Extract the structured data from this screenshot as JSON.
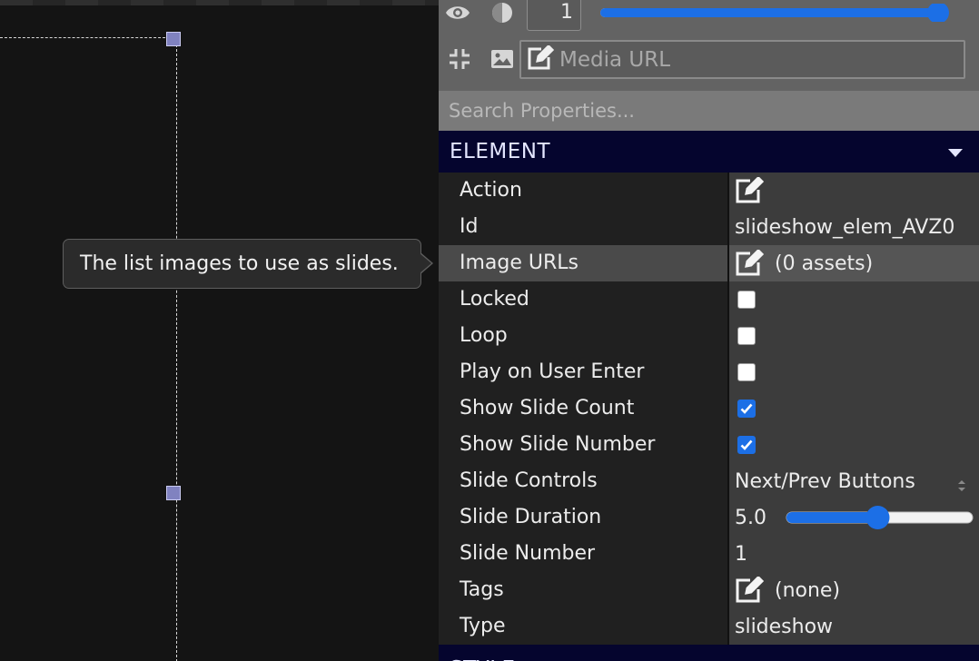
{
  "toolbar": {
    "opacity_value": "1",
    "opacity_level": 1.0,
    "media_url_placeholder": "Media URL",
    "icons": [
      "eye-icon",
      "contrast-icon",
      "collapse-icon",
      "image-icon",
      "edit-icon"
    ]
  },
  "search": {
    "placeholder": "Search Properties..."
  },
  "sections": {
    "element": "ELEMENT",
    "style": "STYLE"
  },
  "tooltip": {
    "text": "The list images to use as slides."
  },
  "properties": [
    {
      "label": "Action",
      "kind": "edit",
      "value": ""
    },
    {
      "label": "Id",
      "kind": "text",
      "value": "slideshow_elem_AVZ0"
    },
    {
      "label": "Image URLs",
      "kind": "edit",
      "value": "(0 assets)"
    },
    {
      "label": "Locked",
      "kind": "checkbox",
      "checked": false
    },
    {
      "label": "Loop",
      "kind": "checkbox",
      "checked": false
    },
    {
      "label": "Play on User Enter",
      "kind": "checkbox",
      "checked": false
    },
    {
      "label": "Show Slide Count",
      "kind": "checkbox",
      "checked": true
    },
    {
      "label": "Show Slide Number",
      "kind": "checkbox",
      "checked": true
    },
    {
      "label": "Slide Controls",
      "kind": "select",
      "value": "Next/Prev Buttons"
    },
    {
      "label": "Slide Duration",
      "kind": "slider",
      "value": "5.0",
      "level": 0.5
    },
    {
      "label": "Slide Number",
      "kind": "text",
      "value": "1"
    },
    {
      "label": "Tags",
      "kind": "edit",
      "value": "(none)"
    },
    {
      "label": "Type",
      "kind": "text",
      "value": "slideshow"
    }
  ],
  "colors": {
    "accent": "#1c6fe6",
    "section_header": "#05052e",
    "selection_handle": "#8082c0"
  }
}
